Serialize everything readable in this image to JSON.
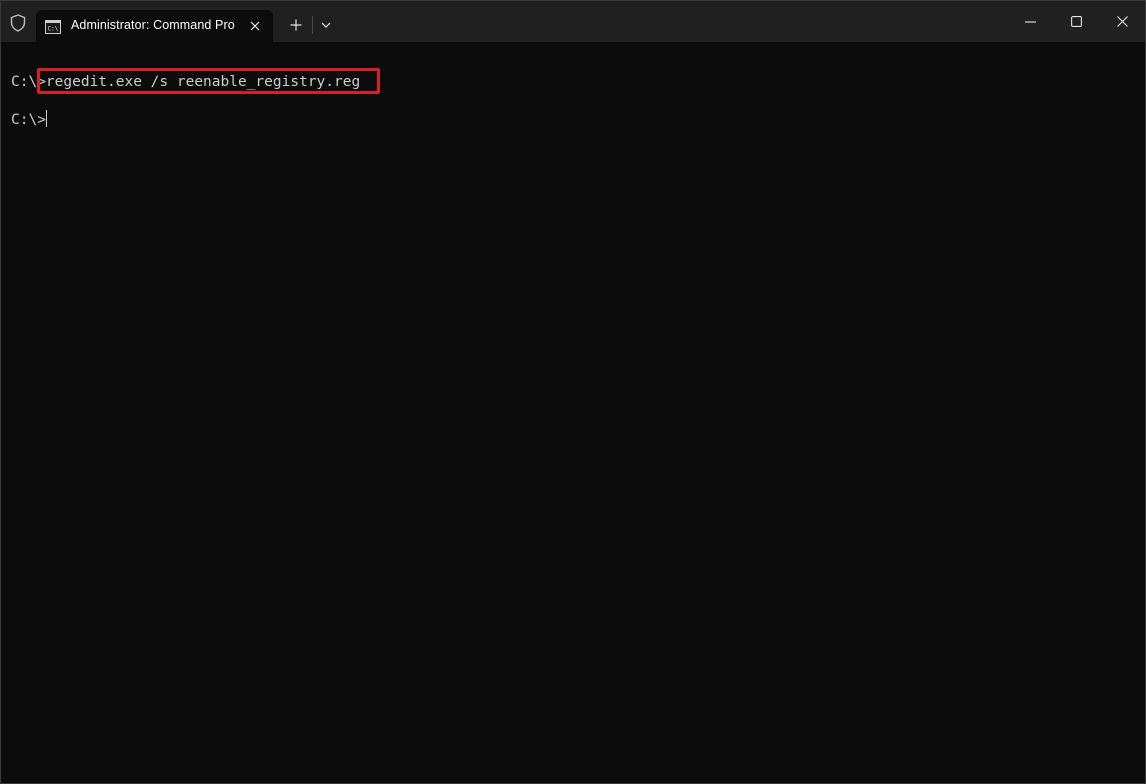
{
  "window": {
    "tab_title": "Administrator: Command Pro",
    "tab_icon": "cmd-icon"
  },
  "titlebar": {
    "shield_icon": "shield-icon",
    "close_tab_icon": "close-icon",
    "new_tab_icon": "plus-icon",
    "dropdown_icon": "chevron-down-icon",
    "minimize_icon": "minimize-icon",
    "maximize_icon": "maximize-icon",
    "close_window_icon": "close-icon"
  },
  "terminal": {
    "line1_prompt": "C:\\>",
    "line1_command": "regedit.exe /s reenable_registry.reg",
    "line2_prompt": "C:\\>"
  },
  "colors": {
    "background": "#0c0c0c",
    "titlebar": "#202020",
    "text": "#cccccc",
    "highlight": "#d62027"
  }
}
